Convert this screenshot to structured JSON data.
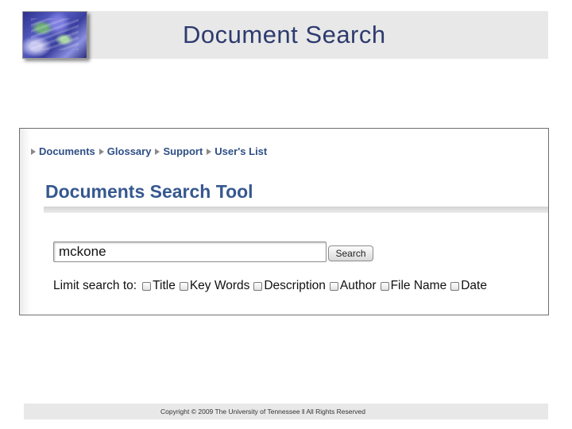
{
  "slide": {
    "title": "Document Search",
    "copyright": "Copyright © 2009 The University of Tennessee ǁ All Rights Reserved"
  },
  "nav": {
    "items": [
      {
        "label": "Documents"
      },
      {
        "label": "Glossary"
      },
      {
        "label": "Support"
      },
      {
        "label": "User's List"
      }
    ]
  },
  "tool": {
    "title": "Documents Search Tool",
    "search_value": "mckone",
    "search_button": "Search",
    "limit_label": "Limit search to:",
    "options": [
      {
        "label": "Title",
        "checked": false
      },
      {
        "label": "Key Words",
        "checked": false
      },
      {
        "label": "Description",
        "checked": false
      },
      {
        "label": "Author",
        "checked": false
      },
      {
        "label": "File Name",
        "checked": false
      },
      {
        "label": "Date",
        "checked": false
      }
    ]
  },
  "colors": {
    "title_text": "#2e3b6e",
    "link_blue": "#2f4f86",
    "band_gray": "#e8e8e8"
  }
}
